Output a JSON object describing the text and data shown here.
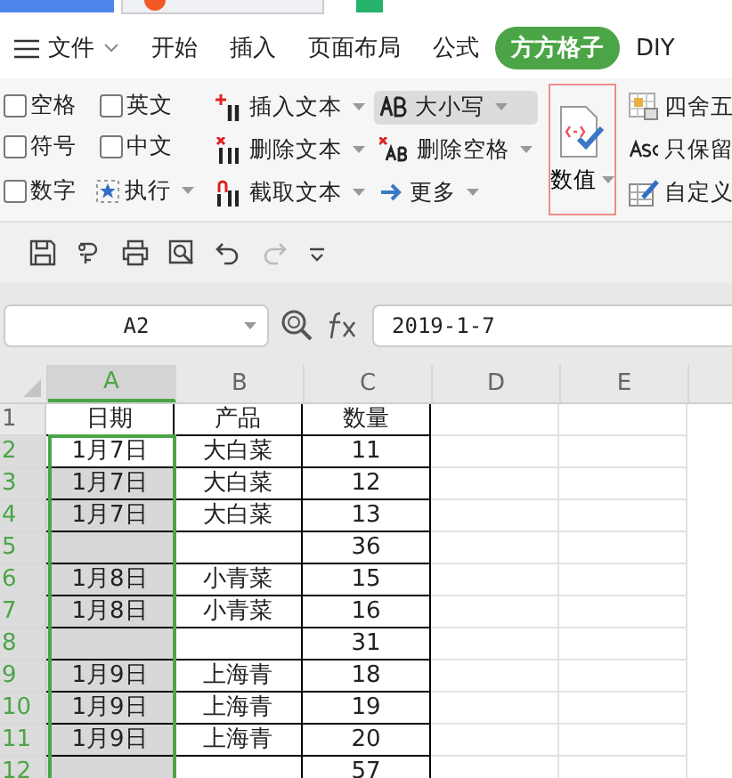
{
  "menu": [
    {
      "label": "文件",
      "kind": "file",
      "selected": false
    },
    {
      "label": "开始",
      "kind": "tab",
      "selected": false
    },
    {
      "label": "插入",
      "kind": "tab",
      "selected": false
    },
    {
      "label": "页面布局",
      "kind": "tab",
      "selected": false
    },
    {
      "label": "公式",
      "kind": "tab",
      "selected": false
    },
    {
      "label": "方方格子",
      "kind": "tab",
      "selected": true
    },
    {
      "label": "DIY",
      "kind": "tab",
      "selected": false
    }
  ],
  "ribbon": {
    "checkboxes": [
      {
        "label": "空格",
        "checked": false
      },
      {
        "label": "英文",
        "checked": false
      },
      {
        "label": "符号",
        "checked": false
      },
      {
        "label": "中文",
        "checked": false
      },
      {
        "label": "数字",
        "checked": false
      }
    ],
    "run_button": "执行",
    "text_tools": [
      {
        "label": "插入文本",
        "kind": "insert",
        "highlighted": false
      },
      {
        "label": "大小写",
        "kind": "case",
        "highlighted": true
      },
      {
        "label": "删除文本",
        "kind": "delete",
        "highlighted": false
      },
      {
        "label": "删除空格",
        "kind": "space",
        "highlighted": false
      },
      {
        "label": "截取文本",
        "kind": "cut",
        "highlighted": false
      },
      {
        "label": "更多",
        "kind": "more",
        "highlighted": false
      }
    ],
    "value_button": {
      "label": "数值",
      "highlighted": true
    },
    "right_tools": [
      {
        "label": "四舍五",
        "kind": "round"
      },
      {
        "label": "只保留",
        "kind": "keep"
      },
      {
        "label": "自定义",
        "kind": "custom"
      }
    ]
  },
  "formula_bar": {
    "name_box": "A2",
    "formula": "2019-1-7"
  },
  "columns": [
    {
      "label": "A",
      "selected": true
    },
    {
      "label": "B",
      "selected": false
    },
    {
      "label": "C",
      "selected": false
    },
    {
      "label": "D",
      "selected": false
    },
    {
      "label": "E",
      "selected": false
    }
  ],
  "rows": [
    {
      "number": "1",
      "selected": false,
      "cells": [
        "日期",
        "产品",
        "数量"
      ]
    },
    {
      "number": "2",
      "selected": true,
      "cells": [
        "1月7日",
        "大白菜",
        "11"
      ]
    },
    {
      "number": "3",
      "selected": true,
      "cells": [
        "1月7日",
        "大白菜",
        "12"
      ]
    },
    {
      "number": "4",
      "selected": true,
      "cells": [
        "1月7日",
        "大白菜",
        "13"
      ]
    },
    {
      "number": "5",
      "selected": true,
      "cells": [
        "",
        "",
        "36"
      ]
    },
    {
      "number": "6",
      "selected": true,
      "cells": [
        "1月8日",
        "小青菜",
        "15"
      ]
    },
    {
      "number": "7",
      "selected": true,
      "cells": [
        "1月8日",
        "小青菜",
        "16"
      ]
    },
    {
      "number": "8",
      "selected": true,
      "cells": [
        "",
        "",
        "31"
      ]
    },
    {
      "number": "9",
      "selected": true,
      "cells": [
        "1月9日",
        "上海青",
        "18"
      ]
    },
    {
      "number": "10",
      "selected": true,
      "cells": [
        "1月9日",
        "上海青",
        "19"
      ]
    },
    {
      "number": "11",
      "selected": true,
      "cells": [
        "1月9日",
        "上海青",
        "20"
      ]
    },
    {
      "number": "12",
      "selected": true,
      "cells": [
        "",
        "",
        "57"
      ]
    }
  ]
}
